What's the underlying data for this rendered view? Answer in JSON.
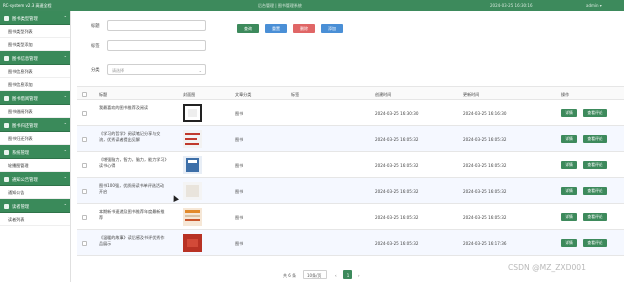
{
  "topbar": {
    "app_title": "RC-system v2.3 高速全程",
    "system_name": "后台管理 | 图书管理系统",
    "time": "2024-03-25 16:30:16",
    "user": "admin ▾"
  },
  "sidebar": {
    "groups": [
      {
        "title": "图书类型管理",
        "subs": [
          "图书类型列表",
          "图书类型添加"
        ]
      },
      {
        "title": "图书信息管理",
        "subs": [
          "图书信息列表",
          "图书信息添加"
        ]
      },
      {
        "title": "图书借阅管理",
        "subs": [
          "图书借阅列表"
        ]
      },
      {
        "title": "图书归还管理",
        "subs": [
          "图书归还列表"
        ]
      },
      {
        "title": "系统管理",
        "subs": [
          "轮播图管理"
        ]
      },
      {
        "title": "通知公告管理",
        "subs": [
          "通知公告"
        ]
      },
      {
        "title": "读者管理",
        "subs": [
          "读者列表"
        ]
      }
    ]
  },
  "search": {
    "title_label": "标题",
    "tags_label": "标签",
    "category_label": "分类",
    "category_placeholder": "请选择",
    "query_btn": "查询",
    "reset_btn": "重置",
    "delete_btn": "删除",
    "add_btn": "添加"
  },
  "colors": {
    "primary": "#3d8a5c",
    "query": "#3d8a5c",
    "reset": "#4a8fd6",
    "delete": "#e06666",
    "add": "#4a8fd6"
  },
  "table": {
    "headers": [
      "标题",
      "封面图",
      "文章分类",
      "标签",
      "创建时间",
      "更新时间",
      "操作"
    ],
    "rows": [
      {
        "title": "我最喜欢的图书推荐及阅读",
        "category": "图书",
        "created": "2024-03-25 16:30:30",
        "updated": "2024-03-25 16:16:30",
        "thumb": "frame"
      },
      {
        "title": "《学习的哲学》阅读笔记分享与交流，优秀读者提出见解",
        "category": "图书",
        "created": "2024-03-25 16:05:32",
        "updated": "2024-03-25 16:05:32",
        "thumb": "bars"
      },
      {
        "title": "《增强脑力，智力，脑力，能力学习》读书心得",
        "category": "图书",
        "created": "2024-03-25 16:05:32",
        "updated": "2024-03-25 16:05:32",
        "thumb": "blue"
      },
      {
        "title": "图书100强，优质阅读书单评选活动开启",
        "category": "图书",
        "created": "2024-03-25 16:05:32",
        "updated": "2024-03-25 16:05:32",
        "thumb": "pale"
      },
      {
        "title": "本期新书速递及图书推荐年度最新推荐",
        "category": "图书",
        "created": "2024-03-25 16:05:32",
        "updated": "2024-03-25 16:05:32",
        "thumb": "orange"
      },
      {
        "title": "《温暖的故事》读后感及书评优秀作品展示",
        "category": "图书",
        "created": "2024-03-25 16:05:32",
        "updated": "2024-03-25 16:17:36",
        "thumb": "red"
      }
    ],
    "detail_btn": "详情",
    "comment_btn": "查看评论"
  },
  "pagination": {
    "total": "共 6 条",
    "page_size": "10条/页",
    "page": "1"
  },
  "watermark": "CSDN @MZ_ZXD001"
}
